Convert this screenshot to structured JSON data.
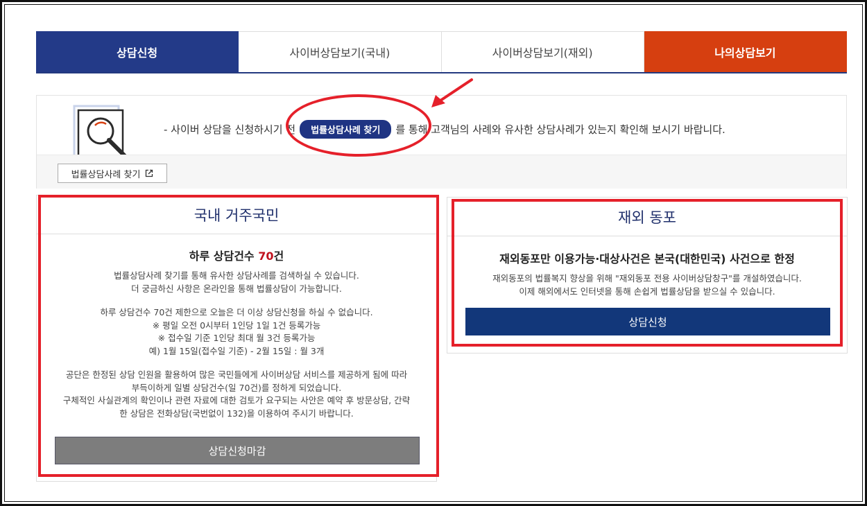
{
  "tabs": [
    {
      "label": "상담신청"
    },
    {
      "label": "사이버상담보기(국내)"
    },
    {
      "label": "사이버상담보기(재외)"
    },
    {
      "label": "나의상담보기"
    }
  ],
  "notice": {
    "text_before": "- 사이버 상담을 신청하시기 전",
    "pill_label": "법률상담사례 찾기",
    "text_after": "를 통해 고객님의 사례와 유사한 상담사례가 있는지 확인해 보시기 바랍니다.",
    "link_button_label": "법률상담사례 찾기"
  },
  "domestic": {
    "title": "국내 거주국민",
    "subtitle_prefix": "하루 상담건수 ",
    "subtitle_count": "70",
    "subtitle_suffix": "건",
    "para1": [
      "법률상담사례 찾기를 통해 유사한 상담사례를 검색하실 수 있습니다.",
      "더 궁금하신 사항은 온라인을 통해 법률상담이 가능합니다."
    ],
    "para2": [
      "하루 상담건수 70건 제한으로 오늘은 더 이상 상담신청을 하실 수 없습니다.",
      "※ 평일 오전 0시부터 1인당 1일 1건 등록가능",
      "※ 접수일 기준 1인당 최대 월 3건 등록가능",
      "예) 1월 15일(접수일 기준) - 2월 15일 : 월 3개"
    ],
    "para3": [
      "공단은 한정된 상담 인원을 활용하여 많은 국민들에게 사이버상담 서비스를 제공하게 됨에 따라",
      "부득이하게 일별 상담건수(일 70건)를 정하게 되었습니다.",
      "구체적인 사실관계의 확인이나 관련 자료에 대한 검토가 요구되는 사안은 예약 후 방문상담, 간략",
      "한 상담은 전화상담(국번없이 132)을 이용하여 주시기 바랍니다."
    ],
    "button_label": "상담신청마감"
  },
  "overseas": {
    "title": "재외 동포",
    "subtitle": "재외동포만 이용가능·대상사건은 본국(대한민국) 사건으로 한정",
    "para": [
      "재외동포의 법률복지 향상을 위해 \"재외동포 전용 사이버상담창구\"를 개설하였습니다.",
      "이제 해외에서도 인터넷을 통해 손쉽게 법률상담을 받으실 수 있습니다."
    ],
    "button_label": "상담신청"
  },
  "colors": {
    "tab_active": "#233a88",
    "tab_accent": "#d63f10",
    "annotation_red": "#e5202a",
    "button_closed": "#7d7d7d",
    "button_apply": "#12377a"
  }
}
